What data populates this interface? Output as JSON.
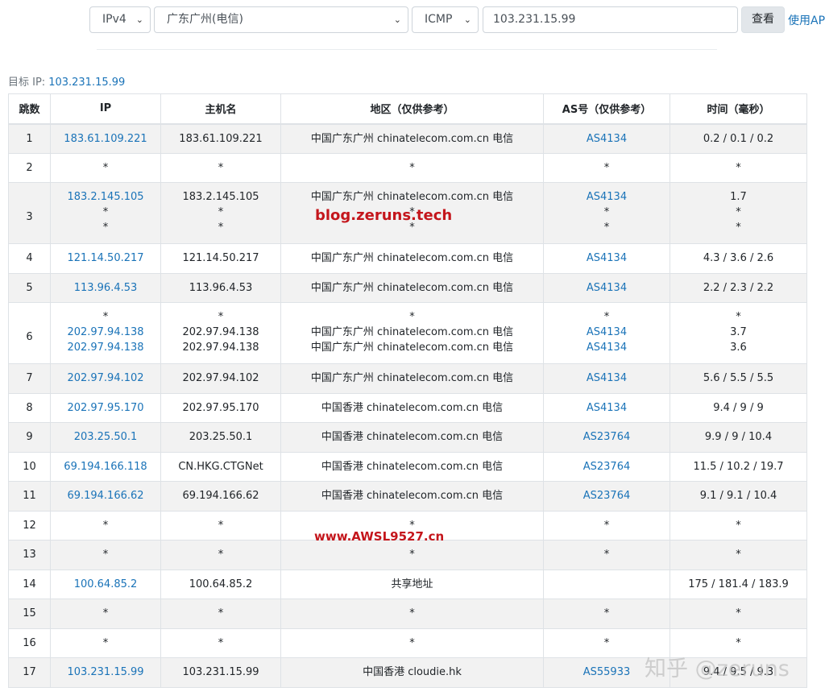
{
  "toolbar": {
    "ip_version": "IPv4",
    "node": "广东广州(电信)",
    "protocol": "ICMP",
    "target_input": "103.231.15.99",
    "query_button": "查看",
    "api_link": "使用AP"
  },
  "target": {
    "label": "目标 IP:",
    "value": "103.231.15.99"
  },
  "table": {
    "headers": [
      "跳数",
      "IP",
      "主机名",
      "地区（仅供参考）",
      "AS号（仅供参考）",
      "时间（毫秒）"
    ],
    "rows": [
      {
        "hop": "1",
        "ip": [
          "183.61.109.221"
        ],
        "host": [
          "183.61.109.221"
        ],
        "region": [
          "中国广东广州 chinatelecom.com.cn 电信"
        ],
        "as": [
          "AS4134"
        ],
        "time": [
          "0.2 / 0.1 / 0.2"
        ]
      },
      {
        "hop": "2",
        "ip": [
          "*"
        ],
        "host": [
          "*"
        ],
        "region": [
          "*"
        ],
        "as": [
          "*"
        ],
        "time": [
          "*"
        ]
      },
      {
        "hop": "3",
        "ip": [
          "183.2.145.105",
          "*",
          "*"
        ],
        "host": [
          "183.2.145.105",
          "*",
          "*"
        ],
        "region": [
          "中国广东广州 chinatelecom.com.cn 电信",
          "*",
          "*"
        ],
        "as": [
          "AS4134",
          "*",
          "*"
        ],
        "time": [
          "1.7",
          "*",
          "*"
        ]
      },
      {
        "hop": "4",
        "ip": [
          "121.14.50.217"
        ],
        "host": [
          "121.14.50.217"
        ],
        "region": [
          "中国广东广州 chinatelecom.com.cn 电信"
        ],
        "as": [
          "AS4134"
        ],
        "time": [
          "4.3 / 3.6 / 2.6"
        ]
      },
      {
        "hop": "5",
        "ip": [
          "113.96.4.53"
        ],
        "host": [
          "113.96.4.53"
        ],
        "region": [
          "中国广东广州 chinatelecom.com.cn 电信"
        ],
        "as": [
          "AS4134"
        ],
        "time": [
          "2.2 / 2.3 / 2.2"
        ]
      },
      {
        "hop": "6",
        "ip": [
          "*",
          "202.97.94.138",
          "202.97.94.138"
        ],
        "host": [
          "*",
          "202.97.94.138",
          "202.97.94.138"
        ],
        "region": [
          "*",
          "中国广东广州 chinatelecom.com.cn 电信",
          "中国广东广州 chinatelecom.com.cn 电信"
        ],
        "as": [
          "*",
          "AS4134",
          "AS4134"
        ],
        "time": [
          "*",
          "3.7",
          "3.6"
        ]
      },
      {
        "hop": "7",
        "ip": [
          "202.97.94.102"
        ],
        "host": [
          "202.97.94.102"
        ],
        "region": [
          "中国广东广州 chinatelecom.com.cn 电信"
        ],
        "as": [
          "AS4134"
        ],
        "time": [
          "5.6 / 5.5 / 5.5"
        ]
      },
      {
        "hop": "8",
        "ip": [
          "202.97.95.170"
        ],
        "host": [
          "202.97.95.170"
        ],
        "region": [
          "中国香港 chinatelecom.com.cn 电信"
        ],
        "as": [
          "AS4134"
        ],
        "time": [
          "9.4 / 9 / 9"
        ]
      },
      {
        "hop": "9",
        "ip": [
          "203.25.50.1"
        ],
        "host": [
          "203.25.50.1"
        ],
        "region": [
          "中国香港 chinatelecom.com.cn 电信"
        ],
        "as": [
          "AS23764"
        ],
        "time": [
          "9.9 / 9 / 10.4"
        ]
      },
      {
        "hop": "10",
        "ip": [
          "69.194.166.118"
        ],
        "host": [
          "CN.HKG.CTGNet"
        ],
        "region": [
          "中国香港 chinatelecom.com.cn 电信"
        ],
        "as": [
          "AS23764"
        ],
        "time": [
          "11.5 / 10.2 / 19.7"
        ]
      },
      {
        "hop": "11",
        "ip": [
          "69.194.166.62"
        ],
        "host": [
          "69.194.166.62"
        ],
        "region": [
          "中国香港 chinatelecom.com.cn 电信"
        ],
        "as": [
          "AS23764"
        ],
        "time": [
          "9.1 / 9.1 / 10.4"
        ]
      },
      {
        "hop": "12",
        "ip": [
          "*"
        ],
        "host": [
          "*"
        ],
        "region": [
          "*"
        ],
        "as": [
          "*"
        ],
        "time": [
          "*"
        ]
      },
      {
        "hop": "13",
        "ip": [
          "*"
        ],
        "host": [
          "*"
        ],
        "region": [
          "*"
        ],
        "as": [
          "*"
        ],
        "time": [
          "*"
        ]
      },
      {
        "hop": "14",
        "ip": [
          "100.64.85.2"
        ],
        "host": [
          "100.64.85.2"
        ],
        "region": [
          "共享地址"
        ],
        "as": [
          ""
        ],
        "time": [
          "175 / 181.4 / 183.9"
        ]
      },
      {
        "hop": "15",
        "ip": [
          "*"
        ],
        "host": [
          "*"
        ],
        "region": [
          "*"
        ],
        "as": [
          "*"
        ],
        "time": [
          "*"
        ]
      },
      {
        "hop": "16",
        "ip": [
          "*"
        ],
        "host": [
          "*"
        ],
        "region": [
          "*"
        ],
        "as": [
          "*"
        ],
        "time": [
          "*"
        ]
      },
      {
        "hop": "17",
        "ip": [
          "103.231.15.99"
        ],
        "host": [
          "103.231.15.99"
        ],
        "region": [
          "中国香港 cloudie.hk"
        ],
        "as": [
          "AS55933"
        ],
        "time": [
          "9.4 / 9.5 / 9.3"
        ]
      }
    ]
  },
  "watermarks": {
    "blog": "blog.zeruns.tech",
    "site": "www.AWSL9527.cn",
    "zhihu": "知乎 @zeruns"
  }
}
